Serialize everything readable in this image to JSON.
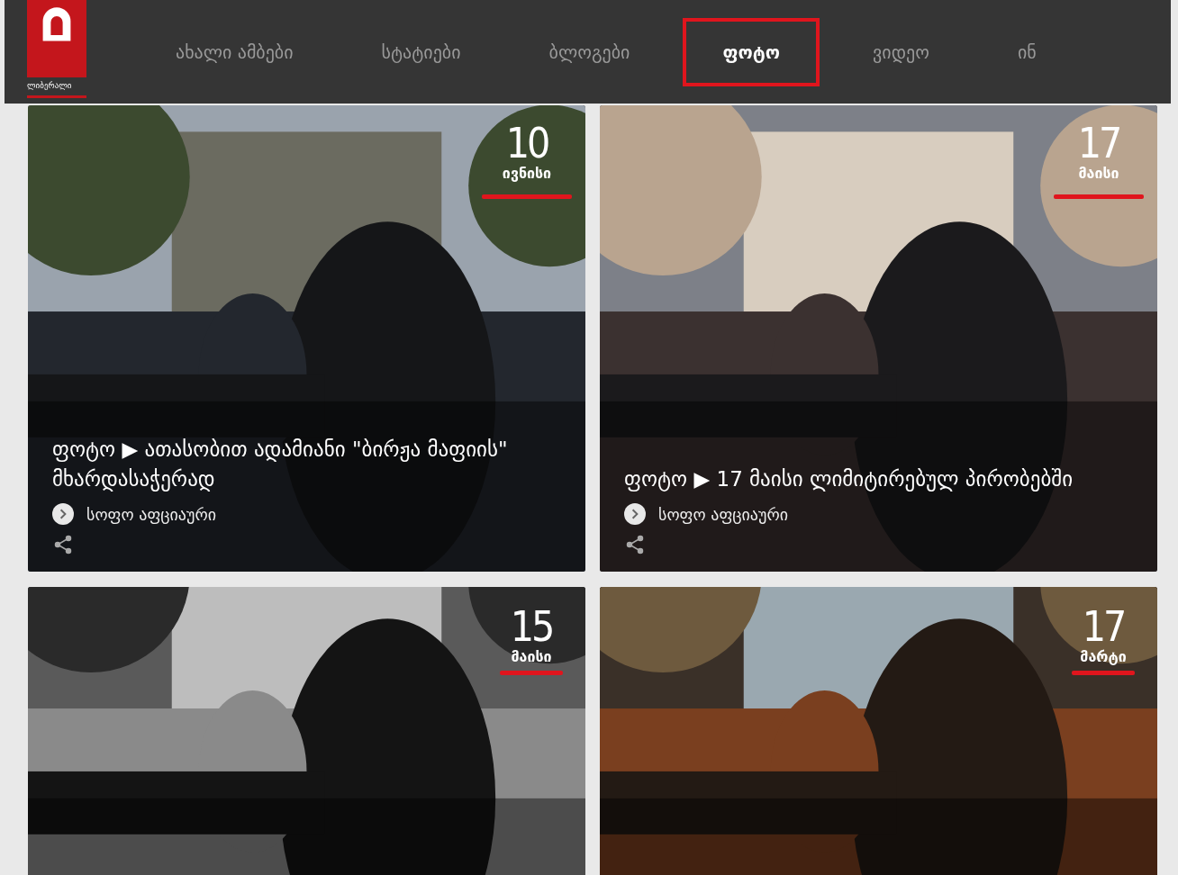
{
  "logo": {
    "text": "ლიბერალი"
  },
  "nav": [
    {
      "label": "ახალი ამბები",
      "selected": false
    },
    {
      "label": "სტატიები",
      "selected": false
    },
    {
      "label": "ბლოგები",
      "selected": false
    },
    {
      "label": "ფოტო",
      "selected": true
    },
    {
      "label": "ვიდეო",
      "selected": false
    },
    {
      "label": "ინ",
      "selected": false
    }
  ],
  "cards": [
    {
      "day": "10",
      "month": "ივნისი",
      "title": "ფოტო ▶ ათასობით ადამიანი \"ბირჟა მაფიის\" მხარდასაჭერად",
      "author": "სოფო აფციაური"
    },
    {
      "day": "17",
      "month": "მაისი",
      "title": "ფოტო ▶ 17 მაისი ლიმიტირებულ პირობებში",
      "author": "სოფო აფციაური"
    },
    {
      "day": "15",
      "month": "მაისი"
    },
    {
      "day": "17",
      "month": "მარტი"
    }
  ]
}
